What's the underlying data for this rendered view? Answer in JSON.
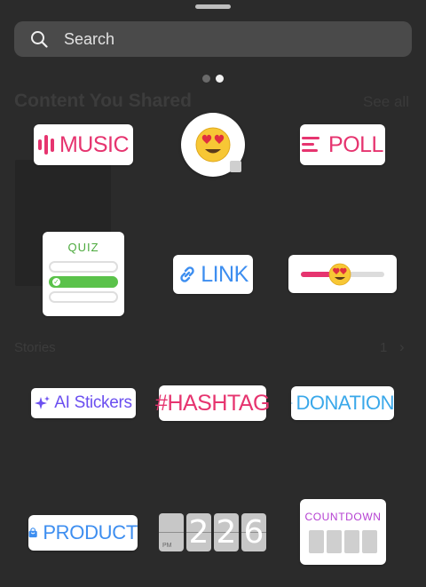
{
  "search": {
    "placeholder": "Search"
  },
  "pager": {
    "pages": 2,
    "current": 2
  },
  "background": {
    "section_title": "Content You Shared",
    "see_all": "See all",
    "stories_label": "Stories",
    "stories_count": "1"
  },
  "stickers": {
    "music": "MUSIC",
    "poll": "POLL",
    "quiz": "QUIZ",
    "link": "LINK",
    "ai": "AI Stickers",
    "hashtag": "#HASHTAG",
    "donation": "DONATION",
    "product": "PRODUCT",
    "countdown": "COUNTDOWN",
    "emoji": "😍",
    "slider_emoji": "😍",
    "slider_level": 0.4
  },
  "clock": {
    "d1": "2",
    "d2": "2",
    "d3": "6",
    "period": "PM"
  },
  "colors": {
    "background": "#2b2b2b",
    "pink": "#e6346f",
    "blue": "#3d8ef0",
    "green": "#5ac24a",
    "purple": "#6b4ff0",
    "violet": "#b43fd1",
    "sky": "#3aa8ea"
  }
}
